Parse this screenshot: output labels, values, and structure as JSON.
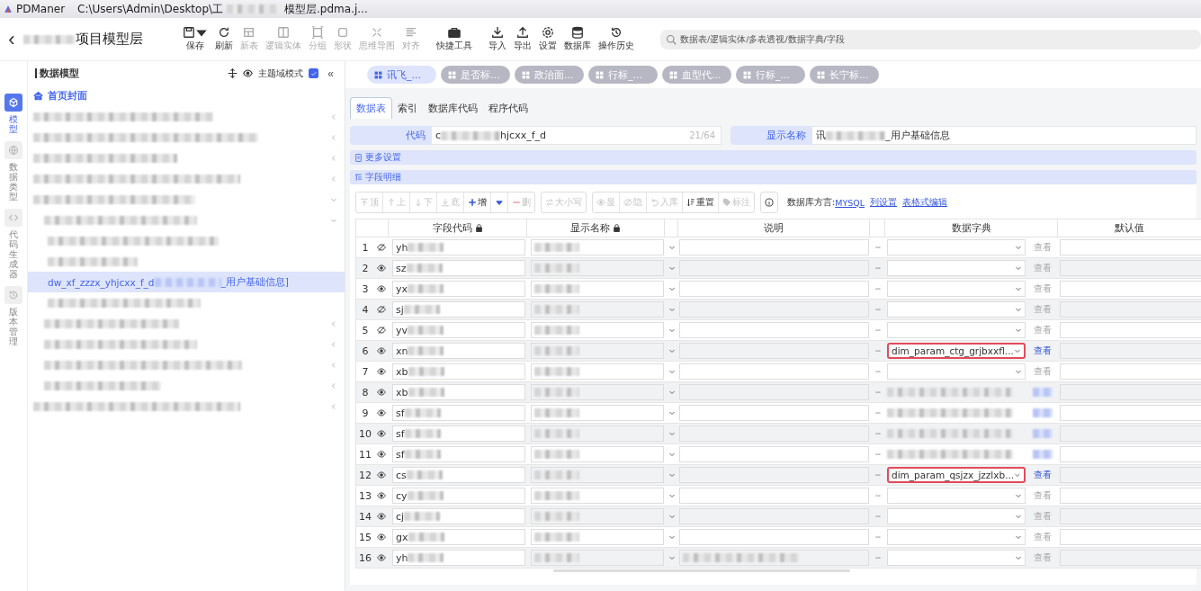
{
  "window": {
    "app": "PDManer",
    "path_parts": [
      "C:\\Users\\Admin\\Desktop\\工",
      {
        "kind": "redacted"
      },
      "模型层.pdma.j..."
    ]
  },
  "header": {
    "back": "‹",
    "title_parts": [
      {
        "kind": "redacted"
      },
      "项目模型层"
    ],
    "toolbar": [
      {
        "label": "保存",
        "enabled": true,
        "dropdown": true
      },
      {
        "label": "刷新",
        "enabled": true
      },
      {
        "label": "新表",
        "enabled": false
      },
      {
        "label": "逻辑实体",
        "enabled": false
      },
      {
        "label": "分组",
        "enabled": false
      },
      {
        "label": "形状",
        "enabled": false
      },
      {
        "label": "思维导图",
        "enabled": false
      },
      {
        "label": "对齐",
        "enabled": false
      },
      {
        "label": "快捷工具",
        "enabled": true
      },
      {
        "label": "导入",
        "enabled": true
      },
      {
        "label": "导出",
        "enabled": true
      },
      {
        "label": "设置",
        "enabled": true
      },
      {
        "label": "数据库",
        "enabled": true
      },
      {
        "label": "操作历史",
        "enabled": true
      }
    ],
    "search": {
      "placeholder": "数据表/逻辑实体/多表透视/数据字典/字段"
    }
  },
  "rail": [
    {
      "label": "模型",
      "selected": true
    },
    {
      "label": "数据类型",
      "selected": false
    },
    {
      "label": "代码生成器",
      "selected": false
    },
    {
      "label": "版本管理",
      "selected": false
    }
  ],
  "sidebar": {
    "title": "数据模型",
    "mode_label": "主题域模式",
    "mode_checked": true,
    "collapse": "«",
    "tree": [
      {
        "kind": "home",
        "label": "首页封面"
      },
      {
        "kind": "group",
        "expanded": false
      },
      {
        "kind": "group",
        "expanded": false
      },
      {
        "kind": "group",
        "expanded": false
      },
      {
        "kind": "group",
        "expanded": false
      },
      {
        "kind": "group",
        "expanded": true,
        "children": [
          {
            "kind": "group",
            "expanded": true,
            "children": [
              {
                "kind": "table",
                "selected": false
              },
              {
                "kind": "table",
                "selected": false
              },
              {
                "kind": "table",
                "selected": true,
                "label_parts": [
                  "dw_xf_zzzx_yhjcxx_f_d",
                  {
                    "kind": "redacted"
                  },
                  "_用户基础信息]"
                ]
              },
              {
                "kind": "table",
                "selected": false
              }
            ]
          },
          {
            "kind": "group",
            "expanded": false
          },
          {
            "kind": "group",
            "expanded": false
          },
          {
            "kind": "group",
            "expanded": false
          },
          {
            "kind": "group",
            "expanded": false
          }
        ]
      },
      {
        "kind": "group",
        "expanded": false
      }
    ]
  },
  "open_tabs": [
    {
      "label": "讯飞_...",
      "selected": true
    },
    {
      "label": "是否标...",
      "selected": false
    },
    {
      "label": "政治面...",
      "selected": false
    },
    {
      "label": "行标_...",
      "selected": false
    },
    {
      "label": "血型代...",
      "selected": false
    },
    {
      "label": "行标_...",
      "selected": false
    },
    {
      "label": "长宁标...",
      "selected": false
    }
  ],
  "editor": {
    "tabs": [
      {
        "label": "数据表",
        "selected": true
      },
      {
        "label": "索引",
        "selected": false
      },
      {
        "label": "数据库代码",
        "selected": false
      },
      {
        "label": "程序代码",
        "selected": false
      }
    ],
    "code_field": {
      "label": "代码",
      "value_parts": [
        "c",
        {
          "kind": "redacted"
        },
        "hjcxx_f_d"
      ],
      "counter": "21/64"
    },
    "name_field": {
      "label": "显示名称",
      "value_parts": [
        "讯",
        {
          "kind": "redacted"
        },
        "_用户基础信息"
      ]
    },
    "sections": [
      "更多设置",
      "字段明细"
    ],
    "field_toolbar": [
      {
        "label": "顶",
        "enabled": false
      },
      {
        "label": "上",
        "enabled": false
      },
      {
        "label": "下",
        "enabled": false
      },
      {
        "label": "底",
        "enabled": false
      },
      {
        "label": "增",
        "enabled": true
      },
      {
        "enabled": true
      },
      {
        "label": "删",
        "enabled": false
      },
      {
        "label": "大小写",
        "enabled": false
      },
      {
        "label": "显",
        "enabled": false
      },
      {
        "label": "隐",
        "enabled": false
      },
      {
        "label": "入库",
        "enabled": false
      },
      {
        "label": "重置",
        "enabled": true
      },
      {
        "label": "标注",
        "enabled": false
      },
      {
        "enabled": true
      }
    ],
    "dialect_label": "数据库方言:",
    "dialect": "MYSQL",
    "links": [
      "列设置",
      "表格式编辑"
    ],
    "columns": [
      "字段代码",
      "显示名称",
      "说明",
      "数据字典",
      "默认值"
    ],
    "rows": [
      {
        "num": "1",
        "code": "yh",
        "visible": false,
        "dictionary": {
          "highlighted": false
        },
        "view": {
          "label": "查看",
          "enabled": false
        }
      },
      {
        "num": "2",
        "code": "sz",
        "visible": true,
        "dictionary": {
          "highlighted": false
        },
        "view": {
          "label": "查看",
          "enabled": false
        }
      },
      {
        "num": "3",
        "code": "yx",
        "visible": true,
        "dictionary": {
          "highlighted": false
        },
        "view": {
          "label": "查看",
          "enabled": false
        }
      },
      {
        "num": "4",
        "code": "sj",
        "visible": false,
        "dictionary": {
          "highlighted": false
        },
        "view": {
          "label": "查看",
          "enabled": false
        }
      },
      {
        "num": "5",
        "code": "yv",
        "visible": false,
        "dictionary": {
          "highlighted": false
        },
        "view": {
          "label": "查看",
          "enabled": false
        }
      },
      {
        "num": "6",
        "code": "xn",
        "visible": true,
        "dictionary": {
          "value": "dim_param_ctg_grjbxxfl...",
          "highlighted": true
        },
        "view": {
          "label": "查看",
          "enabled": true
        }
      },
      {
        "num": "7",
        "code": "xb",
        "visible": true,
        "dictionary": {
          "highlighted": false
        },
        "view": {
          "label": "查看",
          "enabled": false
        }
      },
      {
        "num": "8",
        "code": "xb",
        "visible": true,
        "dictionary": {
          "redacted": true
        }
      },
      {
        "num": "9",
        "code": "sf",
        "visible": true,
        "dictionary": {
          "redacted": true
        }
      },
      {
        "num": "10",
        "code": "sf",
        "visible": true,
        "dictionary": {
          "redacted": true
        }
      },
      {
        "num": "11",
        "code": "sf",
        "visible": true,
        "dictionary": {
          "redacted": true
        }
      },
      {
        "num": "12",
        "code": "cs",
        "visible": true,
        "dictionary": {
          "value": "dim_param_qsjzx_jzzlxb...",
          "highlighted": true
        },
        "view": {
          "label": "查看",
          "enabled": true
        }
      },
      {
        "num": "13",
        "code": "cy",
        "visible": true,
        "dictionary": {
          "highlighted": false
        },
        "view": {
          "label": "查看",
          "enabled": false
        }
      },
      {
        "num": "14",
        "code": "cj",
        "visible": true,
        "dictionary": {
          "highlighted": false
        },
        "view": {
          "label": "查看",
          "enabled": false
        }
      },
      {
        "num": "15",
        "code": "gx",
        "visible": true,
        "dictionary": {
          "highlighted": false
        },
        "view": {
          "label": "查看",
          "enabled": false
        }
      },
      {
        "num": "16",
        "code": "yh",
        "visible": true,
        "desc_redacted": true,
        "dictionary": {
          "highlighted": false
        },
        "view": {
          "label": "查看",
          "enabled": false
        }
      }
    ]
  }
}
